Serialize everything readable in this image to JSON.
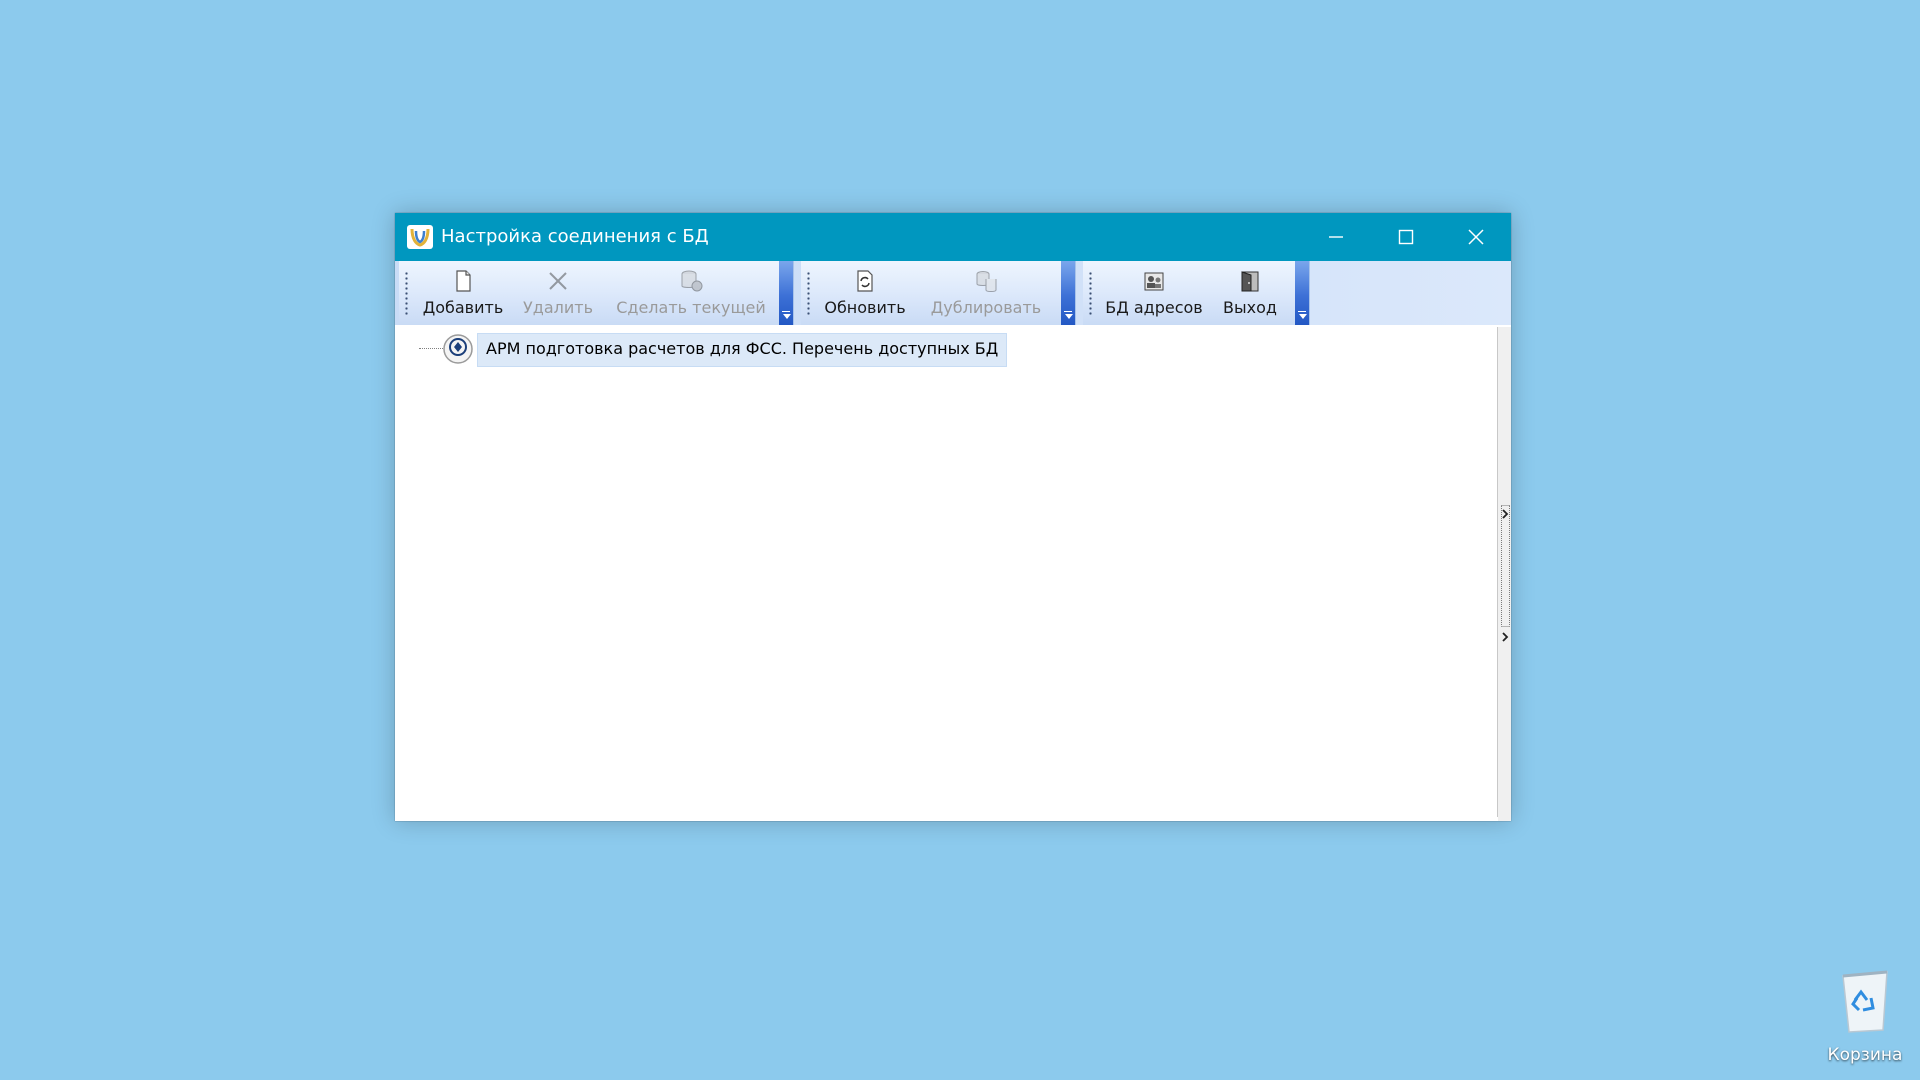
{
  "window": {
    "title": "Настройка соединения с БД",
    "app_icon": "app-logo-icon"
  },
  "toolbar": {
    "groups": [
      {
        "items": [
          {
            "label": "Добавить",
            "icon": "new-document-icon",
            "enabled": true
          },
          {
            "label": "Удалить",
            "icon": "delete-x-icon",
            "enabled": false
          },
          {
            "label": "Сделать текущей",
            "icon": "database-current-icon",
            "enabled": false
          }
        ]
      },
      {
        "items": [
          {
            "label": "Обновить",
            "icon": "refresh-document-icon",
            "enabled": true
          },
          {
            "label": "Дублировать",
            "icon": "duplicate-database-icon",
            "enabled": false
          }
        ]
      },
      {
        "items": [
          {
            "label": "БД адресов",
            "icon": "address-database-icon",
            "enabled": true
          },
          {
            "label": "Выход",
            "icon": "exit-door-icon",
            "enabled": true
          }
        ]
      }
    ]
  },
  "tree": {
    "root_label": "АРМ подготовка расчетов для ФСС. Перечень доступных БД",
    "root_icon": "fss-emblem-icon"
  },
  "desktop": {
    "recycle_bin_label": "Корзина"
  },
  "colors": {
    "desktop_bg": "#8ccaed",
    "titlebar": "#0097bf",
    "selection": "#dce9f8"
  }
}
